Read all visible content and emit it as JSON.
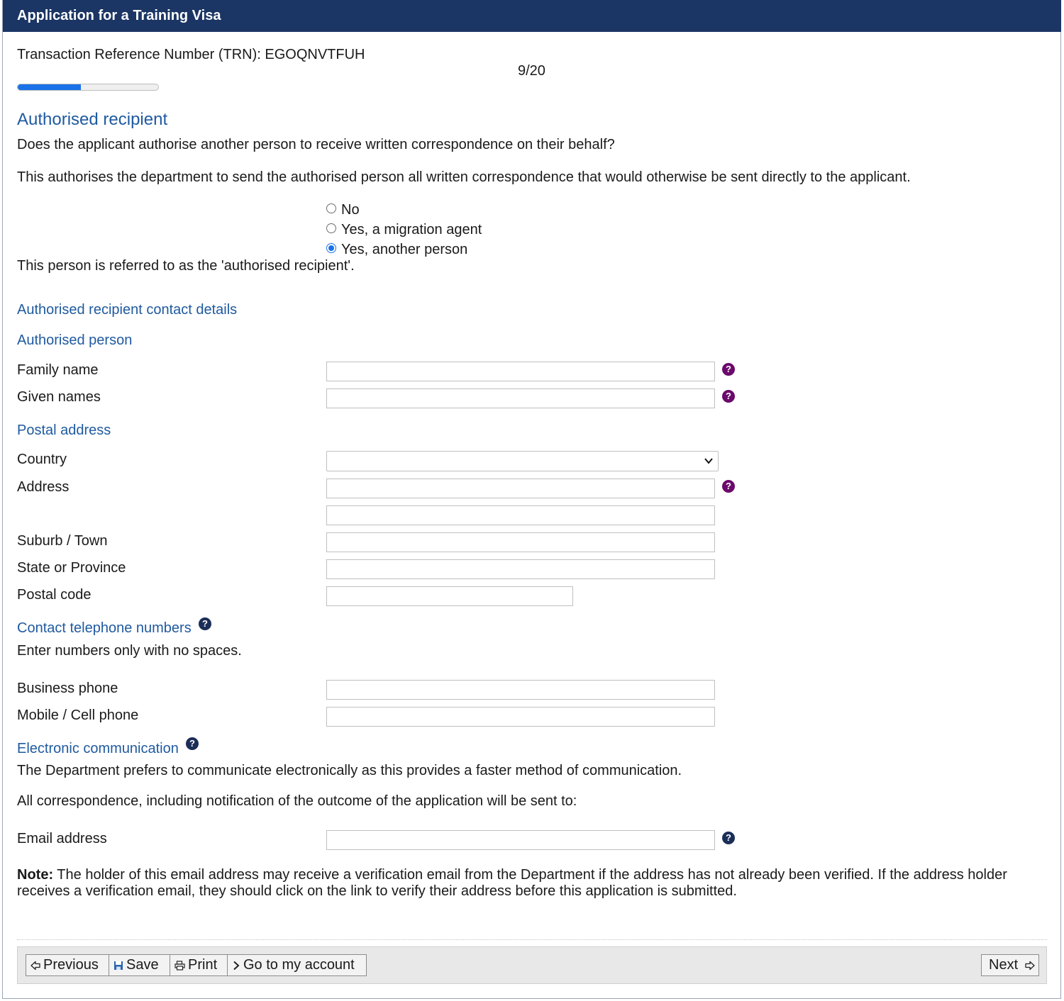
{
  "header": {
    "title": "Application for a Training Visa"
  },
  "trn": {
    "label": "Transaction Reference Number (TRN): EGOQNVTFUH"
  },
  "progress": {
    "text": "9/20",
    "current": 9,
    "total": 20
  },
  "section": {
    "title": "Authorised recipient",
    "question": "Does the applicant authorise another person to receive written correspondence on their behalf?",
    "explain": "This authorises the department to send the authorised person all written correspondence that would otherwise be sent directly to the applicant.",
    "options": [
      {
        "label": "No",
        "selected": false
      },
      {
        "label": "Yes, a migration agent",
        "selected": false
      },
      {
        "label": "Yes, another person",
        "selected": true
      }
    ],
    "referred": "This person is referred to as the 'authorised recipient'."
  },
  "contact": {
    "title": "Authorised recipient contact details",
    "person_title": "Authorised person",
    "family_name": {
      "label": "Family name",
      "value": ""
    },
    "given_names": {
      "label": "Given names",
      "value": ""
    }
  },
  "postal": {
    "title": "Postal address",
    "country": {
      "label": "Country",
      "value": ""
    },
    "address": {
      "label": "Address",
      "line1": "",
      "line2": ""
    },
    "suburb": {
      "label": "Suburb / Town",
      "value": ""
    },
    "state": {
      "label": "State or Province",
      "value": ""
    },
    "postcode": {
      "label": "Postal code",
      "value": ""
    }
  },
  "phones": {
    "title": "Contact telephone numbers",
    "hint": "Enter numbers only with no spaces.",
    "business": {
      "label": "Business phone",
      "value": ""
    },
    "mobile": {
      "label": "Mobile / Cell phone",
      "value": ""
    }
  },
  "electronic": {
    "title": "Electronic communication",
    "prefers": "The Department prefers to communicate electronically as this provides a faster method of communication.",
    "all_corr": "All correspondence, including notification of the outcome of the application will be sent to:",
    "email": {
      "label": "Email address",
      "value": ""
    },
    "note_bold": "Note:",
    "note_line1": " The holder of this email address may receive a verification email from the Department if the address has not already been verified. If the address holder",
    "note_line2": "receives a verification email, they should click on the link to verify their address before this application is submitted."
  },
  "help_icon": "?",
  "footer": {
    "previous": "Previous",
    "save": "Save",
    "print": "Print",
    "account": "Go to my account",
    "next": "Next"
  },
  "colors": {
    "header": "#1b3564",
    "accent": "#1f5aa0",
    "progress": "#1b72e8",
    "help_purple": "#6b0a6b",
    "help_navy": "#1b2e57"
  }
}
